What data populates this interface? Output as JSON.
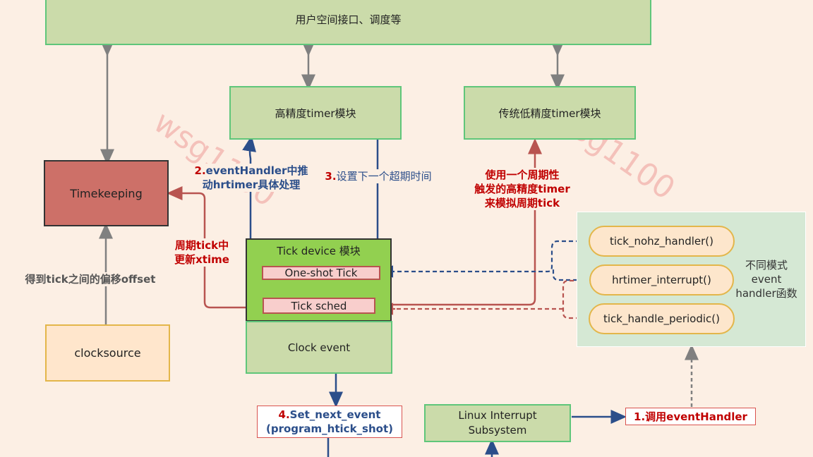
{
  "watermark": "wsg1100",
  "boxes": {
    "user_space": "用户空间接口、调度等",
    "hrtimer": "高精度timer模块",
    "lowres_timer": "传统低精度timer模块",
    "timekeeping": "Timekeeping",
    "clocksource": "clocksource",
    "tick_device": "Tick  device  模块",
    "oneshot_tick": "One-shot  Tick",
    "tick_sched": "Tick  sched",
    "clock_event": "Clock  event",
    "linux_interrupt_line1": "Linux  Interrupt",
    "linux_interrupt_line2": "Subsystem",
    "handlers_group_label_line1": "不同模式",
    "handlers_group_label_line2": "event",
    "handlers_group_label_line3": "handler函数"
  },
  "handlers": [
    "tick_nohz_handler()",
    "hrtimer_interrupt()",
    "tick_handle_periodic()"
  ],
  "labels": {
    "step2_num": "2.",
    "step2_line1": "eventHandler中推",
    "step2_line2": "动hrtimer具体处理",
    "step3_num": "3.",
    "step3_text": "设置下一个超期时间",
    "periodic_line1": "使用一个周期性",
    "periodic_line2": "触发的高精度timer",
    "periodic_line3": "来模拟周期tick",
    "xtime_line1": "周期tick中",
    "xtime_line2": "更新xtime",
    "offset": "得到tick之间的偏移offset",
    "step4_num": "4.",
    "step4_line1": "Set_next_event",
    "step4_line2": "(program_htick_shot)",
    "step1": "1.调用eventHandler"
  },
  "colors": {
    "background": "#fcefe4",
    "green_fill": "#cbdbaa",
    "green_border": "#5fc67a",
    "timekeeping_fill": "#cd7068",
    "tick_device_fill": "#92d050",
    "tick_item_fill": "#f8cecc",
    "tick_item_border": "#b85450",
    "arrow_grey": "#808080",
    "arrow_blue": "#2b4e8a",
    "arrow_red": "#b85450",
    "label_red": "#c00000"
  }
}
